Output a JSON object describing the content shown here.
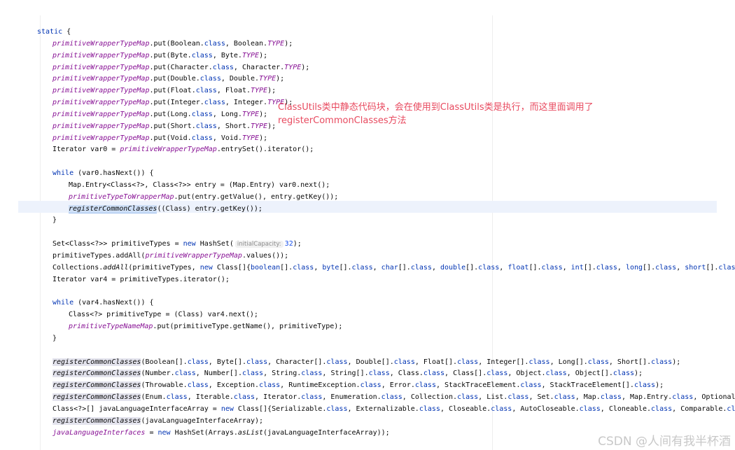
{
  "code": {
    "static_kw": "static",
    "put": ".put(",
    "class_kw": "class",
    "type_const": "TYPE",
    "map_wrapper": "primitiveWrapperTypeMap",
    "map_to_wrapper": "primitiveTypeToWrapperMap",
    "map_name": "primitiveTypeNameMap",
    "wrappers": [
      "Boolean",
      "Byte",
      "Character",
      "Double",
      "Float",
      "Integer",
      "Long",
      "Short",
      "Void"
    ],
    "iterator_line_a": "Iterator var0 = ",
    "iterator_line_b": ".entrySet().iterator();",
    "while_kw": "while",
    "while0_rest": " (var0.hasNext()) {",
    "entry_line": "Map.Entry<Class<?>, Class<?>> entry = (Map.Entry) var0.next();",
    "put_entry_args": "put(entry.getValue(), entry.getKey());",
    "register_method": "registerCommonClasses",
    "register_cast_args": "((Class) entry.getKey());",
    "close_brace": "}",
    "set_line_a": "Set<Class<?>> primitiveTypes = ",
    "new_kw": "new",
    "set_line_b": " HashSet(",
    "hint_label": "initialCapacity:",
    "hint_value": "32",
    "set_line_c": ");",
    "addall_line_a": "primitiveTypes.addAll(",
    "addall_line_b": ".values());",
    "collections_a": "Collections.",
    "collections_m": "addAll",
    "collections_b": "(primitiveTypes, ",
    "collections_c": " Class[]{",
    "prim_arrays": [
      "boolean",
      "byte",
      "char",
      "double",
      "float",
      "int",
      "long",
      "short"
    ],
    "collections_end": "});",
    "iterator4": "Iterator var4 = primitiveTypes.iterator();",
    "while4_rest": " (var4.hasNext()) {",
    "ptype_line": "Class<?> primitiveType = (Class) var4.next();",
    "name_put_args": "put(primitiveType.getName(), primitiveType);",
    "reg1": [
      "Boolean",
      "Byte",
      "Character",
      "Double",
      "Float",
      "Integer",
      "Long",
      "Short"
    ],
    "reg2": [
      [
        "Number",
        ""
      ],
      [
        "Number",
        "[]"
      ],
      [
        "String",
        ""
      ],
      [
        "String",
        "[]"
      ],
      [
        "Class",
        ""
      ],
      [
        "Class",
        "[]"
      ],
      [
        "Object",
        ""
      ],
      [
        "Object",
        "[]"
      ]
    ],
    "reg3": [
      [
        "Throwable",
        ""
      ],
      [
        "Exception",
        ""
      ],
      [
        "RuntimeException",
        ""
      ],
      [
        "Error",
        ""
      ],
      [
        "StackTraceElement",
        ""
      ],
      [
        "StackTraceElement",
        "[]"
      ]
    ],
    "reg4": [
      "Enum",
      "Iterable",
      "Iterator",
      "Enumeration",
      "Collection",
      "List",
      "Set",
      "Map",
      "Map.Entry",
      "Optional"
    ],
    "iface_a": "Class<?>[] javaLanguageInterfaceArray = ",
    "iface_b": " Class[]{",
    "iface_list": [
      "Serializable",
      "Externalizable",
      "Closeable",
      "AutoCloseable",
      "Cloneable",
      "Comparable"
    ],
    "reg_iface_arg": "(javaLanguageInterfaceArray);",
    "last_a": "javaLanguageInterfaces",
    "last_b": " = ",
    "last_c": " HashSet(Arrays.",
    "last_m": "asList",
    "last_d": "(javaLanguageInterfaceArray));"
  },
  "annotation": {
    "line1": "ClassUtils类中静态代码块，会在使用到ClassUtils类是执行，而这里面调用了",
    "line2": "registerCommonClasses方法"
  },
  "watermark": "CSDN @人间有我半杯酒"
}
